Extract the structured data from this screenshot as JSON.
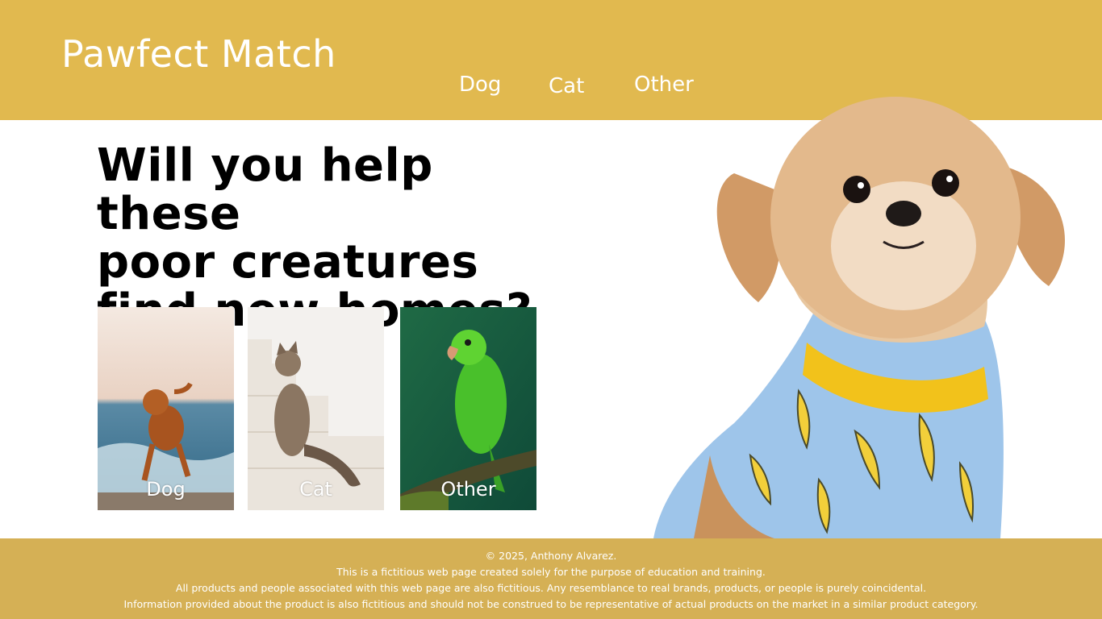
{
  "header": {
    "brand": "Pawfect Match",
    "nav": [
      "Dog",
      "Cat",
      "Other"
    ]
  },
  "hero": {
    "title_lines": [
      "Will you help these",
      "poor creatures",
      "find new homes?"
    ]
  },
  "cards": [
    {
      "label": "Dog"
    },
    {
      "label": "Cat"
    },
    {
      "label": "Other"
    }
  ],
  "footer": {
    "lines": [
      "© 2025, Anthony Alvarez.",
      "This is a fictitious web page created solely for the purpose of education and training.",
      "All products and people associated with this web page are also fictitious. Any resemblance to real brands, products, or people is purely coincidental.",
      "Information provided about the product is also fictitious and should not be construed to be representative of actual products on the market in a similar product category."
    ]
  },
  "colors": {
    "header_bg": "#e1b94f",
    "footer_bg": "#d5b055",
    "text": "#000000"
  },
  "icons": [
    "dog-photo",
    "cat-photo",
    "parrot-photo",
    "dog-in-pajamas-photo"
  ]
}
